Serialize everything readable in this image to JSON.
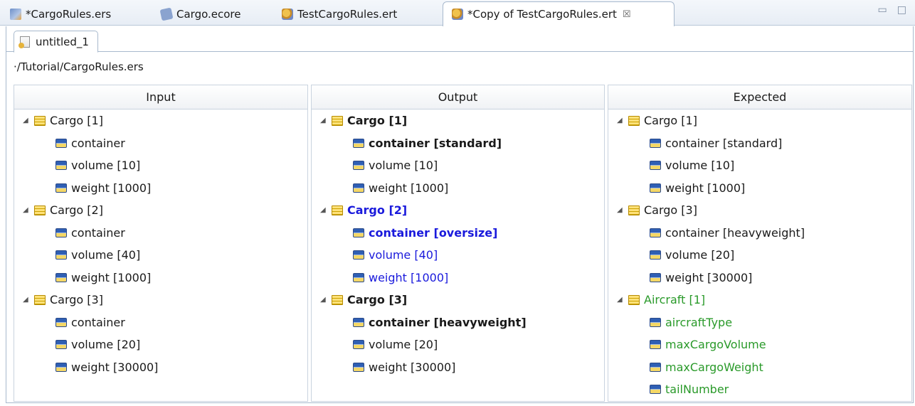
{
  "editor_tabs": [
    {
      "label": "*CargoRules.ers",
      "icon": "rules-file-icon"
    },
    {
      "label": "Cargo.ecore",
      "icon": "ecore-file-icon"
    },
    {
      "label": "TestCargoRules.ert",
      "icon": "test-file-icon"
    },
    {
      "label": "*Copy of TestCargoRules.ert",
      "icon": "test-file-icon",
      "active": true,
      "close": "☒"
    }
  ],
  "window_buttons": {
    "minimize": "▭",
    "maximize": "□"
  },
  "inner_tab": {
    "label": "untitled_1"
  },
  "path": "·/Tutorial/CargoRules.ers",
  "columns": {
    "input": {
      "header": "Input",
      "rows": [
        {
          "text": "Cargo [1]",
          "level": 0,
          "style": ""
        },
        {
          "text": "container",
          "level": 1,
          "style": ""
        },
        {
          "text": "volume [10]",
          "level": 1,
          "style": ""
        },
        {
          "text": "weight [1000]",
          "level": 1,
          "style": ""
        },
        {
          "text": "Cargo [2]",
          "level": 0,
          "style": ""
        },
        {
          "text": "container",
          "level": 1,
          "style": ""
        },
        {
          "text": "volume [40]",
          "level": 1,
          "style": ""
        },
        {
          "text": "weight [1000]",
          "level": 1,
          "style": ""
        },
        {
          "text": "Cargo [3]",
          "level": 0,
          "style": ""
        },
        {
          "text": "container",
          "level": 1,
          "style": ""
        },
        {
          "text": "volume [20]",
          "level": 1,
          "style": ""
        },
        {
          "text": "weight [30000]",
          "level": 1,
          "style": ""
        }
      ]
    },
    "output": {
      "header": "Output",
      "rows": [
        {
          "text": "Cargo [1]",
          "level": 0,
          "style": "bold"
        },
        {
          "text": "container [standard]",
          "level": 1,
          "style": "bold"
        },
        {
          "text": "volume [10]",
          "level": 1,
          "style": ""
        },
        {
          "text": "weight [1000]",
          "level": 1,
          "style": ""
        },
        {
          "text": "Cargo [2]",
          "level": 0,
          "style": "bold blue"
        },
        {
          "text": "container [oversize]",
          "level": 1,
          "style": "bold blue"
        },
        {
          "text": "volume [40]",
          "level": 1,
          "style": "blue"
        },
        {
          "text": "weight [1000]",
          "level": 1,
          "style": "blue"
        },
        {
          "text": "Cargo [3]",
          "level": 0,
          "style": "bold"
        },
        {
          "text": "container [heavyweight]",
          "level": 1,
          "style": "bold"
        },
        {
          "text": "volume [20]",
          "level": 1,
          "style": ""
        },
        {
          "text": "weight [30000]",
          "level": 1,
          "style": ""
        }
      ]
    },
    "expected": {
      "header": "Expected",
      "rows": [
        {
          "text": "Cargo [1]",
          "level": 0,
          "style": ""
        },
        {
          "text": "container [standard]",
          "level": 1,
          "style": ""
        },
        {
          "text": "volume [10]",
          "level": 1,
          "style": ""
        },
        {
          "text": "weight [1000]",
          "level": 1,
          "style": ""
        },
        {
          "text": "Cargo [3]",
          "level": 0,
          "style": ""
        },
        {
          "text": "container [heavyweight]",
          "level": 1,
          "style": ""
        },
        {
          "text": "volume [20]",
          "level": 1,
          "style": ""
        },
        {
          "text": "weight [30000]",
          "level": 1,
          "style": ""
        },
        {
          "text": "Aircraft [1]",
          "level": 0,
          "style": "green"
        },
        {
          "text": "aircraftType",
          "level": 1,
          "style": "green"
        },
        {
          "text": "maxCargoVolume",
          "level": 1,
          "style": "green"
        },
        {
          "text": "maxCargoWeight",
          "level": 1,
          "style": "green"
        },
        {
          "text": "tailNumber",
          "level": 1,
          "style": "green"
        }
      ]
    }
  },
  "colors": {
    "changed": "#1a1adc",
    "missing": "#2a9a2a"
  }
}
